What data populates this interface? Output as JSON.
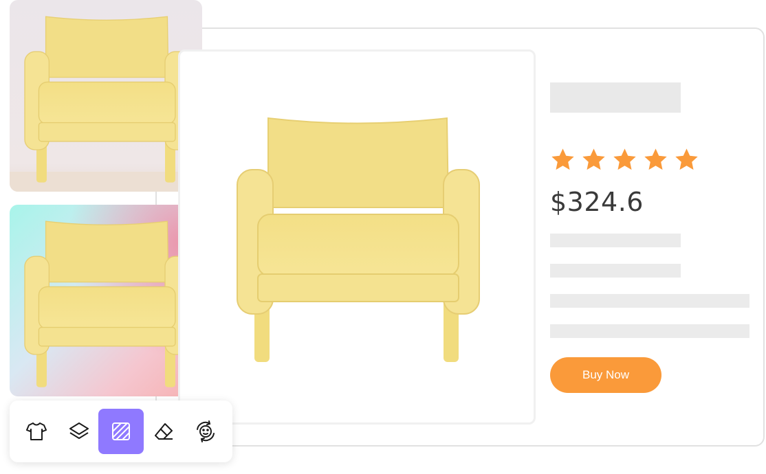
{
  "product": {
    "price": "$324.6",
    "rating": 5,
    "rating_max": 5,
    "buy_button_label": "Buy Now"
  },
  "colors": {
    "accent": "#fa9a3a",
    "star": "#fa9a3a",
    "active_tool": "#8f79ff",
    "chair": "#f6e48c"
  },
  "toolbar": {
    "tools": [
      {
        "icon": "tshirt-icon",
        "active": false
      },
      {
        "icon": "layers-icon",
        "active": false
      },
      {
        "icon": "pattern-icon",
        "active": true
      },
      {
        "icon": "eraser-icon",
        "active": false
      },
      {
        "icon": "face-swap-icon",
        "active": false
      }
    ]
  }
}
